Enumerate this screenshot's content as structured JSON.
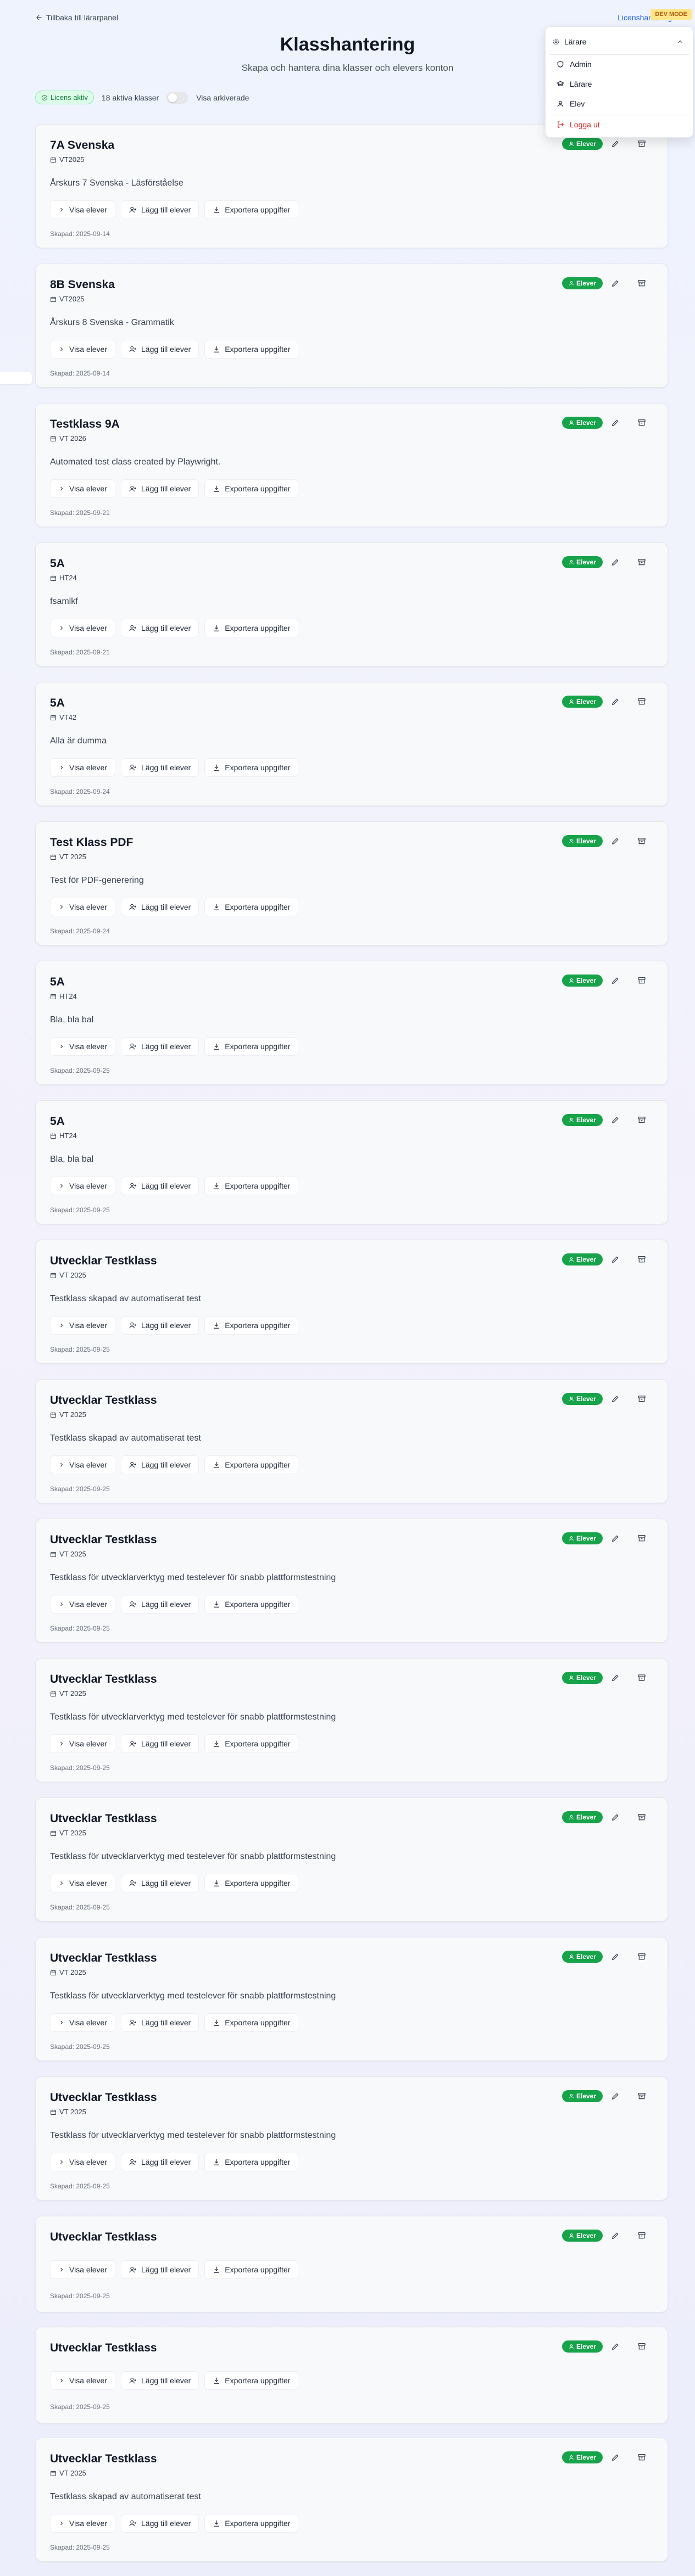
{
  "header": {
    "back_label": "Tillbaka till lärarpanel",
    "licens_label": "Licenshantering",
    "dev_badge": "DEV MODE",
    "title": "Klasshantering",
    "subtitle": "Skapa och hantera dina klasser och elevers konton"
  },
  "filters": {
    "license_status": "Licens aktiv",
    "active_count": "18 aktiva klasser",
    "show_archived_label": "Visa arkiverade"
  },
  "role_menu": {
    "current": "Lärare",
    "options": [
      "Admin",
      "Lärare",
      "Elev"
    ],
    "logout": "Logga ut"
  },
  "card_actions": {
    "view": "Visa elever",
    "add": "Lägg till elever",
    "export": "Exportera uppgifter",
    "badge": "Elever"
  },
  "classes": [
    {
      "name": "7A Svenska",
      "term": "VT2025",
      "desc": "Årskurs 7 Svenska - Läsförståelse",
      "created": "Skapad: 2025-09-14"
    },
    {
      "name": "8B Svenska",
      "term": "VT2025",
      "desc": "Årskurs 8 Svenska - Grammatik",
      "created": "Skapad: 2025-09-14"
    },
    {
      "name": "Testklass 9A",
      "term": "VT 2026",
      "desc": "Automated test class created by Playwright.",
      "created": "Skapad: 2025-09-21"
    },
    {
      "name": "5A",
      "term": "HT24",
      "desc": "fsamlkf",
      "created": "Skapad: 2025-09-21"
    },
    {
      "name": "5A",
      "term": "VT42",
      "desc": "Alla är dumma",
      "created": "Skapad: 2025-09-24"
    },
    {
      "name": "Test Klass PDF",
      "term": "VT 2025",
      "desc": "Test för PDF-generering",
      "created": "Skapad: 2025-09-24"
    },
    {
      "name": "5A",
      "term": "HT24",
      "desc": "Bla, bla bal",
      "created": "Skapad: 2025-09-25"
    },
    {
      "name": "5A",
      "term": "HT24",
      "desc": "Bla, bla bal",
      "created": "Skapad: 2025-09-25"
    },
    {
      "name": "Utvecklar Testklass",
      "term": "VT 2025",
      "desc": "Testklass skapad av automatiserat test",
      "created": "Skapad: 2025-09-25"
    },
    {
      "name": "Utvecklar Testklass",
      "term": "VT 2025",
      "desc": "Testklass skapad av automatiserat test",
      "created": "Skapad: 2025-09-25"
    },
    {
      "name": "Utvecklar Testklass",
      "term": "VT 2025",
      "desc": "Testklass för utvecklarverktyg med testelever för snabb plattformstestning",
      "created": "Skapad: 2025-09-25"
    },
    {
      "name": "Utvecklar Testklass",
      "term": "VT 2025",
      "desc": "Testklass för utvecklarverktyg med testelever för snabb plattformstestning",
      "created": "Skapad: 2025-09-25"
    },
    {
      "name": "Utvecklar Testklass",
      "term": "VT 2025",
      "desc": "Testklass för utvecklarverktyg med testelever för snabb plattformstestning",
      "created": "Skapad: 2025-09-25"
    },
    {
      "name": "Utvecklar Testklass",
      "term": "VT 2025",
      "desc": "Testklass för utvecklarverktyg med testelever för snabb plattformstestning",
      "created": "Skapad: 2025-09-25"
    },
    {
      "name": "Utvecklar Testklass",
      "term": "VT 2025",
      "desc": "Testklass för utvecklarverktyg med testelever för snabb plattformstestning",
      "created": "Skapad: 2025-09-25"
    },
    {
      "name": "Utvecklar Testklass",
      "term": "",
      "desc": "",
      "created": "Skapad: 2025-09-25"
    },
    {
      "name": "Utvecklar Testklass",
      "term": "",
      "desc": "",
      "created": "Skapad: 2025-09-25"
    },
    {
      "name": "Utvecklar Testklass",
      "term": "VT 2025",
      "desc": "Testklass skapad av automatiserat test",
      "created": "Skapad: 2025-09-25"
    }
  ]
}
